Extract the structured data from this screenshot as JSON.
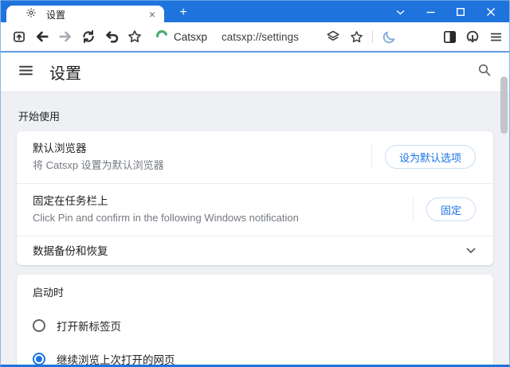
{
  "tab": {
    "title": "设置"
  },
  "toolbar": {
    "brand": "Catsxp",
    "url": "catsxp://settings"
  },
  "header": {
    "title": "设置"
  },
  "content": {
    "section_label": "开始使用",
    "rows": [
      {
        "title": "默认浏览器",
        "subtitle": "将 Catsxp 设置为默认浏览器",
        "button": "设为默认选项"
      },
      {
        "title": "固定在任务栏上",
        "subtitle": "Click Pin and confirm in the following Windows notification",
        "button": "固定"
      },
      {
        "title": "数据备份和恢复"
      }
    ],
    "startup": {
      "label": "启动时",
      "options": [
        {
          "label": "打开新标签页",
          "selected": false
        },
        {
          "label": "继续浏览上次打开的网页",
          "selected": true
        }
      ]
    }
  },
  "icons": {
    "tab_close": "×",
    "new_tab": "+",
    "star": "☆"
  },
  "colors": {
    "titlebar_blue": "#1e74dc",
    "divider_blue": "#5f9ce6",
    "link_blue": "#1a73e8",
    "moon_blue": "#7fabdd",
    "logo_blue": "#3b8ce9",
    "logo_green": "#4cae67"
  }
}
